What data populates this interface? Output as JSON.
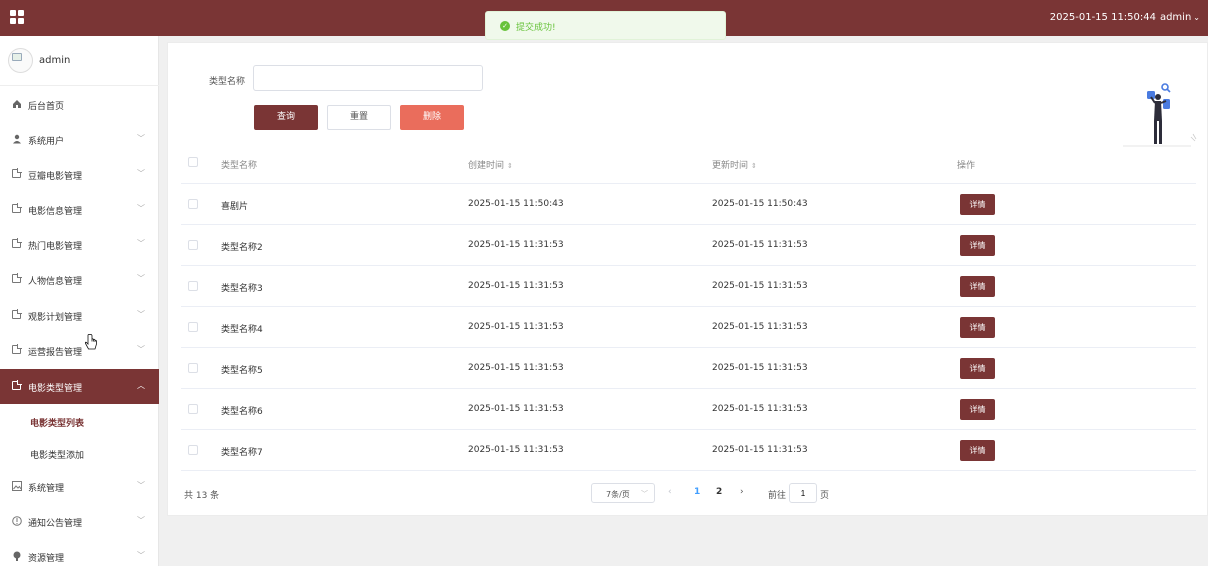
{
  "topbar": {
    "datetime": "2025-01-15 11:50:44",
    "user": "admin",
    "caret": "⌄"
  },
  "toast": {
    "message": "提交成功!"
  },
  "sidebar": {
    "username": "admin",
    "items": [
      {
        "label": "后台首页",
        "icon": "home-icon"
      },
      {
        "label": "系统用户",
        "icon": "user-icon"
      },
      {
        "label": "豆瓣电影管理",
        "icon": "doc-icon"
      },
      {
        "label": "电影信息管理",
        "icon": "doc-icon"
      },
      {
        "label": "热门电影管理",
        "icon": "doc-icon"
      },
      {
        "label": "人物信息管理",
        "icon": "doc-icon"
      },
      {
        "label": "观影计划管理",
        "icon": "doc-icon"
      },
      {
        "label": "运营报告管理",
        "icon": "doc-icon"
      },
      {
        "label": "电影类型管理",
        "icon": "doc-icon"
      },
      {
        "label": "系统管理",
        "icon": "image-icon"
      },
      {
        "label": "通知公告管理",
        "icon": "info-icon"
      },
      {
        "label": "资源管理",
        "icon": "resource-icon"
      }
    ],
    "subitems": [
      {
        "label": "电影类型列表"
      },
      {
        "label": "电影类型添加"
      }
    ]
  },
  "search": {
    "label": "类型名称",
    "value": "",
    "placeholder": ""
  },
  "buttons": {
    "query": "查询",
    "reset": "重置",
    "delete": "删除"
  },
  "table": {
    "headers": {
      "name": "类型名称",
      "created": "创建时间",
      "updated": "更新时间",
      "op": "操作"
    },
    "sort_icon": "⇕",
    "detail_label": "详情",
    "rows": [
      {
        "name": "喜剧片",
        "created": "2025-01-15 11:50:43",
        "updated": "2025-01-15 11:50:43"
      },
      {
        "name": "类型名称2",
        "created": "2025-01-15 11:31:53",
        "updated": "2025-01-15 11:31:53"
      },
      {
        "name": "类型名称3",
        "created": "2025-01-15 11:31:53",
        "updated": "2025-01-15 11:31:53"
      },
      {
        "name": "类型名称4",
        "created": "2025-01-15 11:31:53",
        "updated": "2025-01-15 11:31:53"
      },
      {
        "name": "类型名称5",
        "created": "2025-01-15 11:31:53",
        "updated": "2025-01-15 11:31:53"
      },
      {
        "name": "类型名称6",
        "created": "2025-01-15 11:31:53",
        "updated": "2025-01-15 11:31:53"
      },
      {
        "name": "类型名称7",
        "created": "2025-01-15 11:31:53",
        "updated": "2025-01-15 11:31:53"
      }
    ]
  },
  "pagination": {
    "total": "共 13 条",
    "page_size": "7条/页",
    "pages": [
      "1",
      "2"
    ],
    "current_page": 1,
    "goto_pre": "前往",
    "goto_value": "1",
    "goto_post": "页"
  },
  "colors": {
    "brand": "#7a3535",
    "danger": "#ea6d5c",
    "success": "#67c23a",
    "link": "#409eff"
  }
}
